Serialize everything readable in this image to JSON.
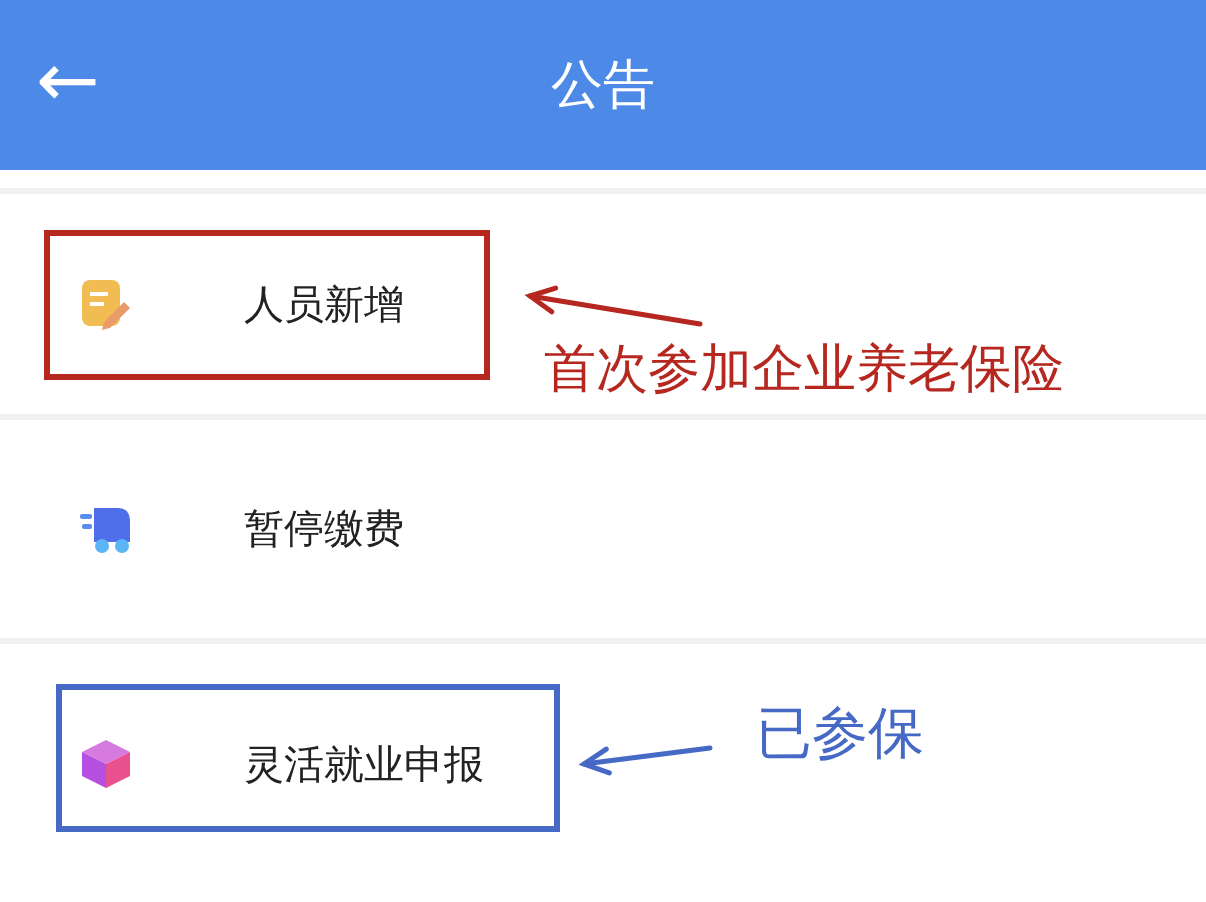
{
  "header": {
    "back": "←",
    "title": "公告"
  },
  "items": [
    {
      "label": "人员新增",
      "annotation": {
        "text": "首次参加企业养老保险",
        "color": "#b5271f"
      }
    },
    {
      "label": "暂停缴费"
    },
    {
      "label": "灵活就业申报",
      "annotation": {
        "text": "已参保",
        "color": "#4669c6"
      }
    }
  ]
}
